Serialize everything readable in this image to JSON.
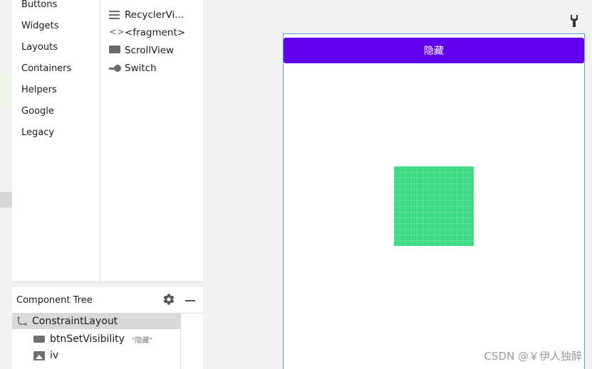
{
  "palette": {
    "categories": [
      "Buttons",
      "Widgets",
      "Layouts",
      "Containers",
      "Helpers",
      "Google",
      "Legacy"
    ],
    "widgets": [
      {
        "label": "RecyclerVi...",
        "icon": "recycler-view-icon"
      },
      {
        "label": "<fragment>",
        "icon": "fragment-icon"
      },
      {
        "label": "ScrollView",
        "icon": "scroll-view-icon"
      },
      {
        "label": "Switch",
        "icon": "switch-icon"
      }
    ],
    "partial_widget_icon": "image-view-icon"
  },
  "component_tree": {
    "title": "Component Tree",
    "root": {
      "label": "ConstraintLayout",
      "icon": "constraint-layout-icon"
    },
    "children": [
      {
        "label": "btnSetVisibility",
        "attr": "\"隐藏\"",
        "icon": "button-icon"
      },
      {
        "label": "iv",
        "icon": "image-view-icon"
      }
    ]
  },
  "design": {
    "button_text": "隐藏",
    "button_color": "#6200ee",
    "image_color": "#3ddc84"
  },
  "watermark": "CSDN @￥伊人独醉"
}
